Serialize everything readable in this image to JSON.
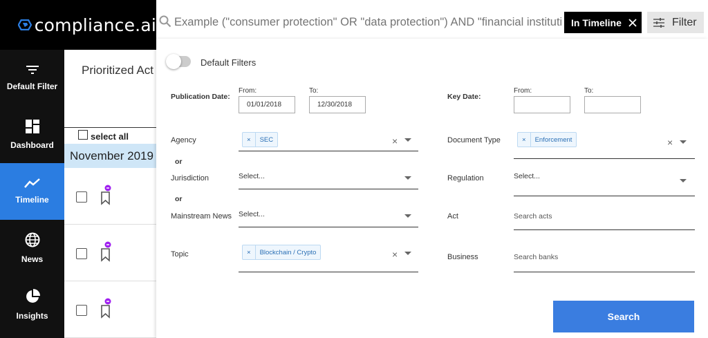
{
  "app": {
    "logo_text": "compliance.ai"
  },
  "sidebar": {
    "items": [
      {
        "label": "Default Filter",
        "icon": "filter-lines-icon"
      },
      {
        "label": "Dashboard",
        "icon": "dashboard-icon"
      },
      {
        "label": "Timeline",
        "icon": "timeline-icon",
        "active": true
      },
      {
        "label": "News",
        "icon": "globe-icon"
      },
      {
        "label": "Insights",
        "icon": "pie-chart-icon"
      }
    ]
  },
  "background": {
    "page_title": "Prioritized Act",
    "select_all": "select all",
    "month": "November 2019"
  },
  "search": {
    "placeholder": "Example (\"consumer protection\" OR \"data protection\") AND \"financial institution\"",
    "chip_label": "In Timeline",
    "filter_label": "Filter"
  },
  "filters": {
    "default_filters_label": "Default Filters",
    "publication_date": {
      "label": "Publication Date:",
      "from_label": "From:",
      "from_value": "01/01/2018",
      "to_label": "To:",
      "to_value": "12/30/2018"
    },
    "key_date": {
      "label": "Key Date:",
      "from_label": "From:",
      "from_value": "",
      "to_label": "To:",
      "to_value": ""
    },
    "agency": {
      "label": "Agency",
      "chip": "SEC"
    },
    "or_1": "or",
    "jurisdiction": {
      "label": "Jurisdiction",
      "placeholder": "Select..."
    },
    "or_2": "or",
    "mainstream_news": {
      "label": "Mainstream News",
      "placeholder": "Select..."
    },
    "topic": {
      "label": "Topic",
      "chip": "Blockchain / Crypto"
    },
    "document_type": {
      "label": "Document Type",
      "chip": "Enforcement"
    },
    "regulation": {
      "label": "Regulation",
      "placeholder": "Select..."
    },
    "act": {
      "label": "Act",
      "placeholder": "Search acts"
    },
    "business": {
      "label": "Business",
      "placeholder": "Search banks"
    },
    "search_button": "Search"
  },
  "colors": {
    "accent": "#2b7de1",
    "search_button": "#3a7de0",
    "chip_bg": "#eef6fd",
    "chip_text": "#2a6fb5",
    "badge": "#a020f0"
  }
}
